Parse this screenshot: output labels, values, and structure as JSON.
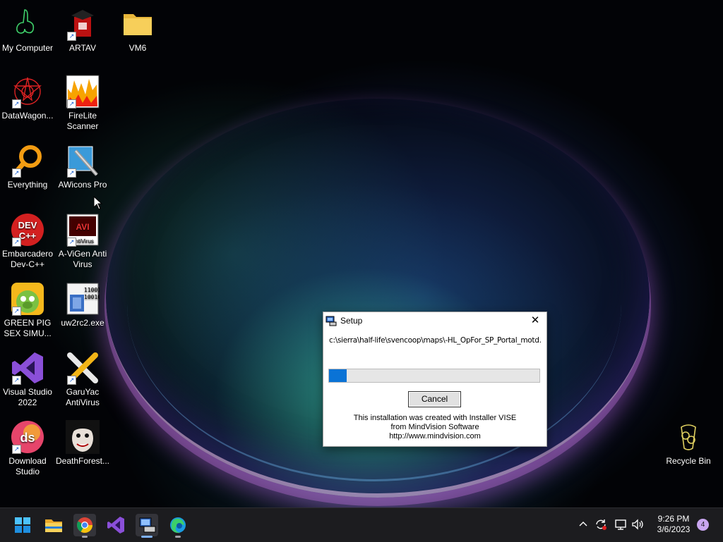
{
  "desktop": {
    "icons": [
      {
        "label": "My Computer",
        "icon": "my-computer-icon",
        "shortcut": false
      },
      {
        "label": "ARTAV",
        "icon": "artav-icon",
        "shortcut": true
      },
      {
        "label": "VM6",
        "icon": "folder-icon",
        "shortcut": false
      },
      {
        "label": "DataWagon...",
        "icon": "datawagon-icon",
        "shortcut": true
      },
      {
        "label": "FireLite Scanner",
        "icon": "firelite-icon",
        "shortcut": true
      },
      {
        "label": "Everything",
        "icon": "everything-search-icon",
        "shortcut": true
      },
      {
        "label": "AWicons Pro",
        "icon": "awicons-icon",
        "shortcut": true
      },
      {
        "label": "Embarcadero Dev-C++",
        "icon": "devcpp-icon",
        "shortcut": true
      },
      {
        "label": "A-ViGen Anti Virus",
        "icon": "avigen-icon",
        "shortcut": true
      },
      {
        "label": "GREEN PIG SEX SIMU...",
        "icon": "green-pig-icon",
        "shortcut": true
      },
      {
        "label": "uw2rc2.exe",
        "icon": "uw2rc2-icon",
        "shortcut": false
      },
      {
        "label": "Visual Studio 2022",
        "icon": "visual-studio-icon",
        "shortcut": true
      },
      {
        "label": "GaruYac AntiVirus",
        "icon": "garuyac-icon",
        "shortcut": true
      },
      {
        "label": "Download Studio",
        "icon": "download-studio-icon",
        "shortcut": true
      },
      {
        "label": "DeathForest...",
        "icon": "deathforest-icon",
        "shortcut": false
      },
      {
        "label": "Recycle Bin",
        "icon": "recycle-bin-icon",
        "shortcut": false
      }
    ],
    "avigen_badge": "AntiVirus",
    "uw2rc2_text": "110010\n100100\n001\n011",
    "devcpp_text": "DEV\nC++",
    "ds_text": "ds"
  },
  "dialog": {
    "title": "Setup",
    "close_glyph": "✕",
    "path": "c:\\sierra\\half-life\\svencoop\\maps\\-HL_OpFor_SP_Portal_motd.",
    "progress": 0.085,
    "cancel_label": "Cancel",
    "credit_line1": "This installation was created with Installer VISE",
    "credit_line2": "from MindVision Software",
    "credit_line3": "http://www.mindvision.com"
  },
  "taskbar": {
    "apps": [
      "start-icon",
      "file-explorer-icon",
      "chrome-icon",
      "visual-studio-icon",
      "setup-installer-icon",
      "edge-icon"
    ],
    "clock_time": "9:26 PM",
    "clock_date": "3/6/2023",
    "notification_count": "4"
  },
  "colors": {
    "accent": "#0a73d6",
    "taskbar": "#1c1c1f"
  }
}
